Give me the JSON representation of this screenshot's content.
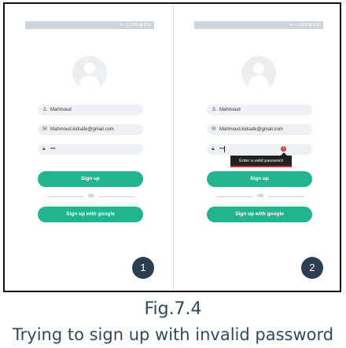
{
  "screens": [
    {
      "status_text": "ᯤ .ıl 100% ▮ 8:00",
      "username": "Mahmoud",
      "email": "Mahmoud.kidsafe@gmail.com",
      "password_mask": "•••",
      "signup_label": "Sign up",
      "or_label": "OR",
      "google_label": "Sign up with google",
      "badge": "1"
    },
    {
      "status_text": "ᯤ .ıl 100% ▮ 8:00",
      "username": "Mahmoud",
      "email": "Mahmoud.kidsafe@gmail.com",
      "password_mask": "•••",
      "error_icon": "!",
      "error_tooltip": "Enter a valid password",
      "signup_label": "Sign up",
      "or_label": "OR",
      "google_label": "Sign up with google",
      "badge": "2"
    }
  ],
  "caption": {
    "figure": "Fig.7.4",
    "text": "Trying to sign up with invalid password"
  },
  "icons": {
    "user": "user-icon",
    "email": "mail-icon",
    "password": "lock-icon",
    "error": "error-icon"
  },
  "colors": {
    "accent": "#22b48e",
    "badge": "#2b3f50",
    "error": "#e53935",
    "caption": "#2f4a5f"
  }
}
